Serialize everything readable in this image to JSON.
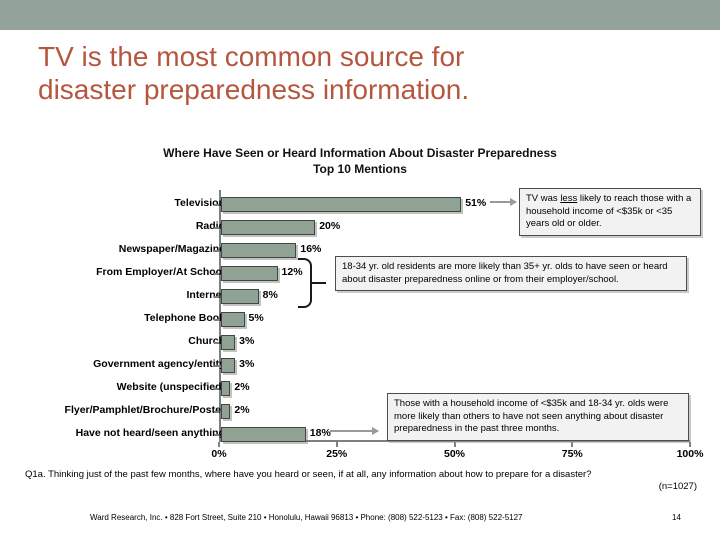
{
  "slide": {
    "title_line1": "TV is the most common source for",
    "title_line2": "disaster preparedness information.",
    "title_color": "#b5563f",
    "band_color": "#93a399",
    "page_number": "14"
  },
  "chart_heading": {
    "line1": "Where Have Seen or Heard Information About Disaster Preparedness",
    "line2": "Top 10 Mentions"
  },
  "chart_data": {
    "type": "bar",
    "orientation": "horizontal",
    "title": "Where Have Seen or Heard Information About Disaster Preparedness Top 10 Mentions",
    "xlabel": "",
    "ylabel": "",
    "xlim": [
      0,
      100
    ],
    "xticks": [
      "0%",
      "25%",
      "50%",
      "75%",
      "100%"
    ],
    "xtick_values": [
      0,
      25,
      50,
      75,
      100
    ],
    "grid": false,
    "legend": "none",
    "bar_color": "#8fa294",
    "categories": [
      "Television",
      "Radio",
      "Newspaper/Magazine",
      "From Employer/At School",
      "Internet",
      "Telephone Book",
      "Church",
      "Government agency/entity",
      "Website (unspecified)",
      "Flyer/Pamphlet/Brochure/Poster",
      "Have not heard/seen anything"
    ],
    "values": [
      51,
      20,
      16,
      12,
      8,
      5,
      3,
      3,
      2,
      2,
      18
    ],
    "value_labels": [
      "51%",
      "20%",
      "16%",
      "12%",
      "8%",
      "5%",
      "3%",
      "3%",
      "2%",
      "2%",
      "18%"
    ]
  },
  "callouts": [
    {
      "id": "tv-callout",
      "text_before": "TV was ",
      "emphasis": "less",
      "text_after": " likely to reach those with a household income of <$35k or <35 years old or older."
    },
    {
      "id": "age-callout",
      "text": "18-34 yr. old residents are more likely than 35+ yr. olds to have seen or heard about disaster preparedness online or from their employer/school."
    },
    {
      "id": "not-heard-callout",
      "text": "Those with a household income of  <$35k and 18-34 yr. olds were more likely than others to have not seen anything about disaster preparedness in the past three months."
    }
  ],
  "footer": {
    "question": "Q1a. Thinking just of the past few months, where have you heard or seen, if at all, any information about how to prepare for a disaster?",
    "base": "(n=1027)",
    "credit": "Ward Research, Inc. • 828 Fort Street, Suite 210 • Honolulu, Hawaii 96813 • Phone: (808) 522-5123 • Fax: (808) 522-5127"
  }
}
